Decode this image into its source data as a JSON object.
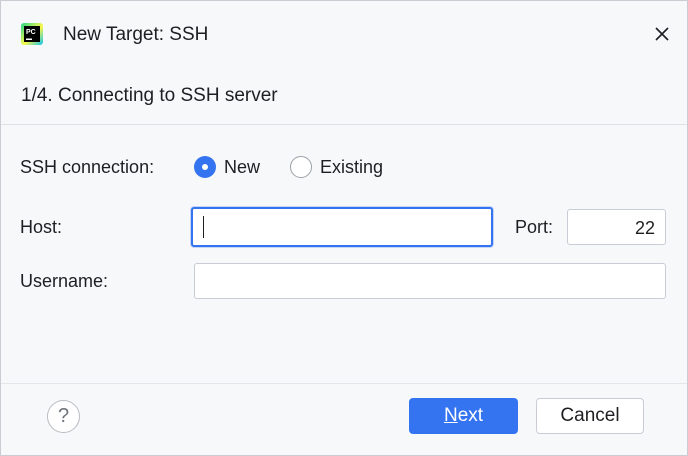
{
  "window": {
    "title": "New Target: SSH",
    "app_icon": "pycharm-logo",
    "app_icon_text": "PC"
  },
  "step": {
    "text": "1/4. Connecting to SSH server"
  },
  "form": {
    "ssh_connection_label": "SSH connection:",
    "options": [
      {
        "label": "New",
        "selected": true
      },
      {
        "label": "Existing",
        "selected": false
      }
    ],
    "host_label": "Host:",
    "host_value": "",
    "port_label": "Port:",
    "port_value": "22",
    "username_label": "Username:",
    "username_value": ""
  },
  "footer": {
    "help_label": "?",
    "next_mnemonic": "N",
    "next_rest": "ext",
    "cancel_label": "Cancel"
  },
  "colors": {
    "accent": "#3574f0",
    "background": "#f7f8fa"
  }
}
